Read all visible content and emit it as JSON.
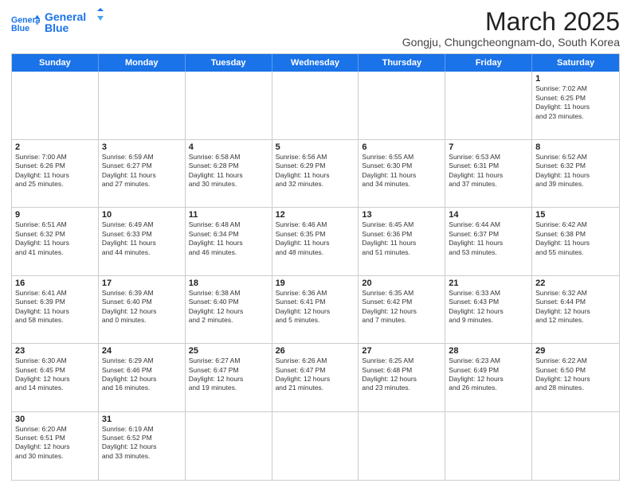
{
  "header": {
    "logo_line1": "General",
    "logo_line2": "Blue",
    "month_title": "March 2025",
    "subtitle": "Gongju, Chungcheongnam-do, South Korea"
  },
  "weekdays": [
    "Sunday",
    "Monday",
    "Tuesday",
    "Wednesday",
    "Thursday",
    "Friday",
    "Saturday"
  ],
  "weeks": [
    [
      {
        "day": "",
        "info": ""
      },
      {
        "day": "",
        "info": ""
      },
      {
        "day": "",
        "info": ""
      },
      {
        "day": "",
        "info": ""
      },
      {
        "day": "",
        "info": ""
      },
      {
        "day": "",
        "info": ""
      },
      {
        "day": "1",
        "info": "Sunrise: 7:02 AM\nSunset: 6:25 PM\nDaylight: 11 hours\nand 23 minutes."
      }
    ],
    [
      {
        "day": "2",
        "info": "Sunrise: 7:00 AM\nSunset: 6:26 PM\nDaylight: 11 hours\nand 25 minutes."
      },
      {
        "day": "3",
        "info": "Sunrise: 6:59 AM\nSunset: 6:27 PM\nDaylight: 11 hours\nand 27 minutes."
      },
      {
        "day": "4",
        "info": "Sunrise: 6:58 AM\nSunset: 6:28 PM\nDaylight: 11 hours\nand 30 minutes."
      },
      {
        "day": "5",
        "info": "Sunrise: 6:56 AM\nSunset: 6:29 PM\nDaylight: 11 hours\nand 32 minutes."
      },
      {
        "day": "6",
        "info": "Sunrise: 6:55 AM\nSunset: 6:30 PM\nDaylight: 11 hours\nand 34 minutes."
      },
      {
        "day": "7",
        "info": "Sunrise: 6:53 AM\nSunset: 6:31 PM\nDaylight: 11 hours\nand 37 minutes."
      },
      {
        "day": "8",
        "info": "Sunrise: 6:52 AM\nSunset: 6:32 PM\nDaylight: 11 hours\nand 39 minutes."
      }
    ],
    [
      {
        "day": "9",
        "info": "Sunrise: 6:51 AM\nSunset: 6:32 PM\nDaylight: 11 hours\nand 41 minutes."
      },
      {
        "day": "10",
        "info": "Sunrise: 6:49 AM\nSunset: 6:33 PM\nDaylight: 11 hours\nand 44 minutes."
      },
      {
        "day": "11",
        "info": "Sunrise: 6:48 AM\nSunset: 6:34 PM\nDaylight: 11 hours\nand 46 minutes."
      },
      {
        "day": "12",
        "info": "Sunrise: 6:46 AM\nSunset: 6:35 PM\nDaylight: 11 hours\nand 48 minutes."
      },
      {
        "day": "13",
        "info": "Sunrise: 6:45 AM\nSunset: 6:36 PM\nDaylight: 11 hours\nand 51 minutes."
      },
      {
        "day": "14",
        "info": "Sunrise: 6:44 AM\nSunset: 6:37 PM\nDaylight: 11 hours\nand 53 minutes."
      },
      {
        "day": "15",
        "info": "Sunrise: 6:42 AM\nSunset: 6:38 PM\nDaylight: 11 hours\nand 55 minutes."
      }
    ],
    [
      {
        "day": "16",
        "info": "Sunrise: 6:41 AM\nSunset: 6:39 PM\nDaylight: 11 hours\nand 58 minutes."
      },
      {
        "day": "17",
        "info": "Sunrise: 6:39 AM\nSunset: 6:40 PM\nDaylight: 12 hours\nand 0 minutes."
      },
      {
        "day": "18",
        "info": "Sunrise: 6:38 AM\nSunset: 6:40 PM\nDaylight: 12 hours\nand 2 minutes."
      },
      {
        "day": "19",
        "info": "Sunrise: 6:36 AM\nSunset: 6:41 PM\nDaylight: 12 hours\nand 5 minutes."
      },
      {
        "day": "20",
        "info": "Sunrise: 6:35 AM\nSunset: 6:42 PM\nDaylight: 12 hours\nand 7 minutes."
      },
      {
        "day": "21",
        "info": "Sunrise: 6:33 AM\nSunset: 6:43 PM\nDaylight: 12 hours\nand 9 minutes."
      },
      {
        "day": "22",
        "info": "Sunrise: 6:32 AM\nSunset: 6:44 PM\nDaylight: 12 hours\nand 12 minutes."
      }
    ],
    [
      {
        "day": "23",
        "info": "Sunrise: 6:30 AM\nSunset: 6:45 PM\nDaylight: 12 hours\nand 14 minutes."
      },
      {
        "day": "24",
        "info": "Sunrise: 6:29 AM\nSunset: 6:46 PM\nDaylight: 12 hours\nand 16 minutes."
      },
      {
        "day": "25",
        "info": "Sunrise: 6:27 AM\nSunset: 6:47 PM\nDaylight: 12 hours\nand 19 minutes."
      },
      {
        "day": "26",
        "info": "Sunrise: 6:26 AM\nSunset: 6:47 PM\nDaylight: 12 hours\nand 21 minutes."
      },
      {
        "day": "27",
        "info": "Sunrise: 6:25 AM\nSunset: 6:48 PM\nDaylight: 12 hours\nand 23 minutes."
      },
      {
        "day": "28",
        "info": "Sunrise: 6:23 AM\nSunset: 6:49 PM\nDaylight: 12 hours\nand 26 minutes."
      },
      {
        "day": "29",
        "info": "Sunrise: 6:22 AM\nSunset: 6:50 PM\nDaylight: 12 hours\nand 28 minutes."
      }
    ],
    [
      {
        "day": "30",
        "info": "Sunrise: 6:20 AM\nSunset: 6:51 PM\nDaylight: 12 hours\nand 30 minutes."
      },
      {
        "day": "31",
        "info": "Sunrise: 6:19 AM\nSunset: 6:52 PM\nDaylight: 12 hours\nand 33 minutes."
      },
      {
        "day": "",
        "info": ""
      },
      {
        "day": "",
        "info": ""
      },
      {
        "day": "",
        "info": ""
      },
      {
        "day": "",
        "info": ""
      },
      {
        "day": "",
        "info": ""
      }
    ]
  ]
}
